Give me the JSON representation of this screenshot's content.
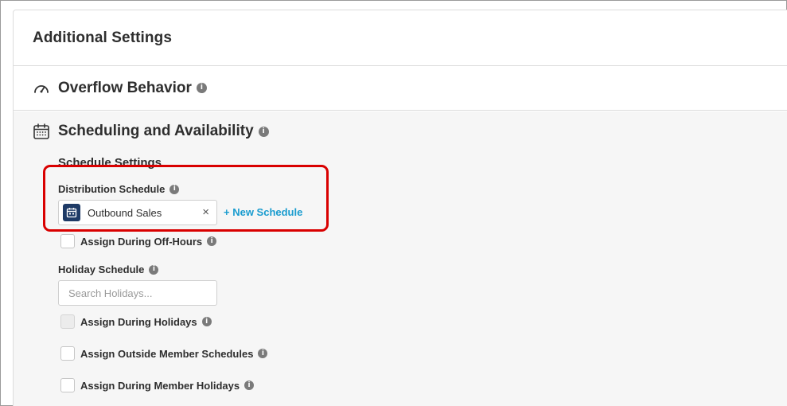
{
  "card": {
    "title": "Additional Settings"
  },
  "overflow": {
    "title": "Overflow Behavior",
    "icon": "gauge-icon"
  },
  "scheduling": {
    "title": "Scheduling and Availability",
    "icon": "calendar-icon",
    "subtitle": "Schedule Settings",
    "distribution": {
      "label": "Distribution Schedule",
      "selected": "Outbound Sales",
      "new_link": "+ New Schedule"
    },
    "off_hours": {
      "label": "Assign During Off-Hours",
      "checked": false
    },
    "holiday": {
      "label": "Holiday Schedule",
      "placeholder": "Search Holidays..."
    },
    "during_holidays": {
      "label": "Assign During Holidays",
      "checked": false,
      "disabled": true
    },
    "outside_member": {
      "label": "Assign Outside Member Schedules",
      "checked": false
    },
    "member_holidays": {
      "label": "Assign During Member Holidays",
      "checked": false
    }
  },
  "colors": {
    "highlight": "#d90000",
    "link": "#1a9ccf",
    "calendar_badge": "#1e3a66"
  }
}
